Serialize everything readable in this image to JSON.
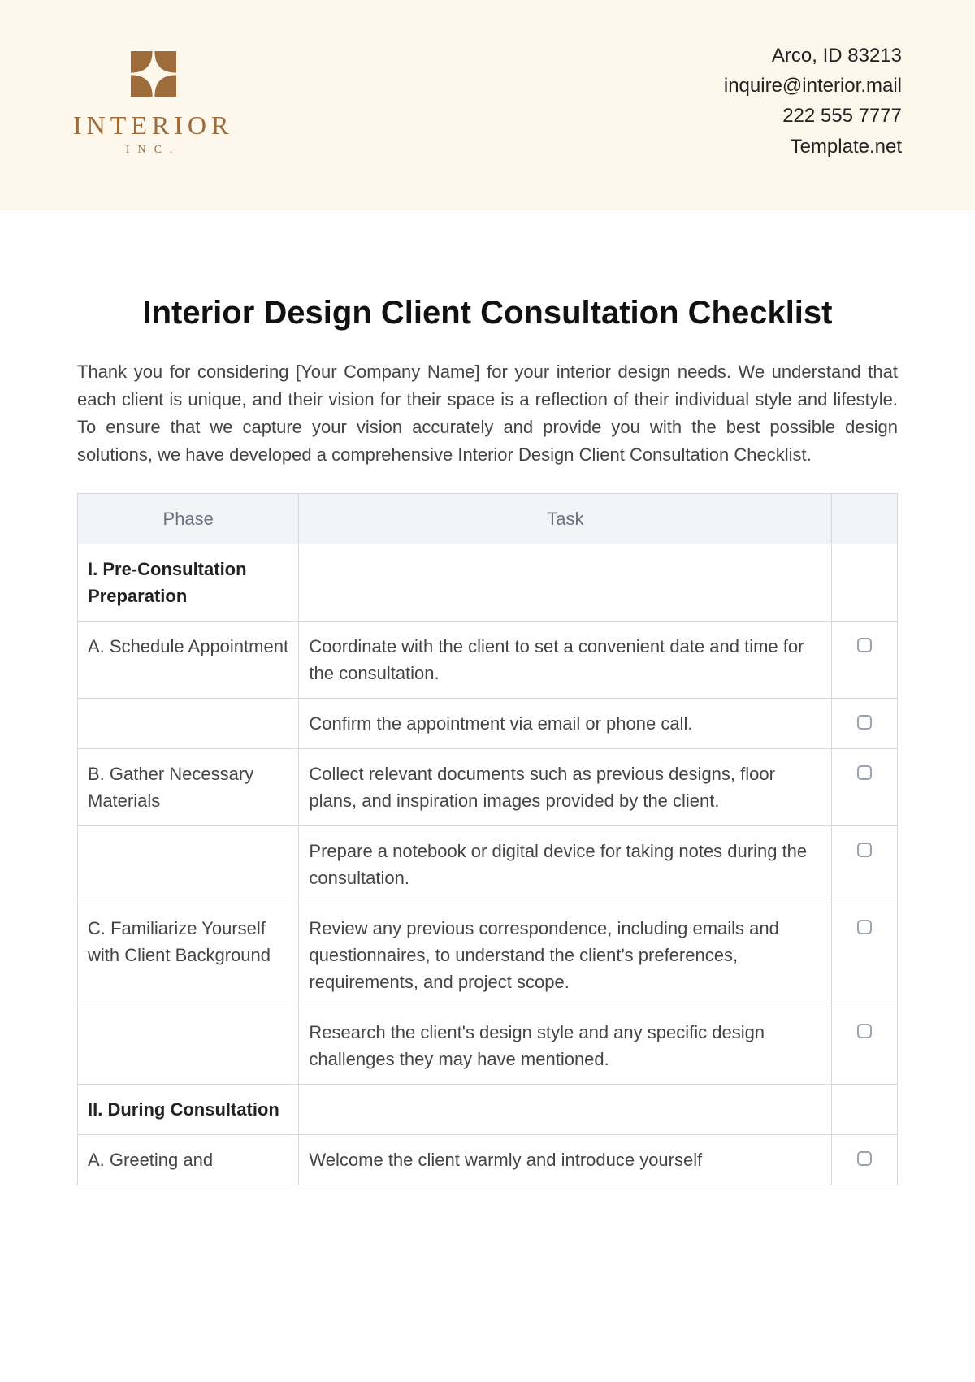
{
  "header": {
    "logo": {
      "name": "INTERIOR",
      "sub": "INC."
    },
    "contact": {
      "address": "Arco, ID 83213",
      "email": "inquire@interior.mail",
      "phone": "222 555 7777",
      "site": "Template.net"
    }
  },
  "title": "Interior Design Client Consultation Checklist",
  "intro": "Thank you for considering [Your Company Name] for your interior design needs. We understand that each client is unique, and their vision for their space is a reflection of their individual style and lifestyle. To ensure that we capture your vision accurately and provide you with the best possible design solutions, we have developed a comprehensive Interior Design Client Consultation Checklist.",
  "columns": {
    "phase": "Phase",
    "task": "Task"
  },
  "rows": [
    {
      "phase": "I. Pre-Consultation Preparation",
      "task": "",
      "isHead": true,
      "check": false
    },
    {
      "phase": "A. Schedule Appointment",
      "task": "Coordinate with the client to set a convenient date and time for the consultation.",
      "isHead": false,
      "check": true
    },
    {
      "phase": "",
      "task": "Confirm the appointment via email or phone call.",
      "isHead": false,
      "check": true
    },
    {
      "phase": "B. Gather Necessary Materials",
      "task": "Collect relevant documents such as previous designs, floor plans, and inspiration images provided by the client.",
      "isHead": false,
      "check": true
    },
    {
      "phase": "",
      "task": "Prepare a notebook or digital device for taking notes during the consultation.",
      "isHead": false,
      "check": true
    },
    {
      "phase": "C. Familiarize Yourself with Client Background",
      "task": "Review any previous correspondence, including emails and questionnaires, to understand the client's preferences, requirements, and project scope.",
      "isHead": false,
      "check": true
    },
    {
      "phase": "",
      "task": "Research the client's design style and any specific design challenges they may have mentioned.",
      "isHead": false,
      "check": true
    },
    {
      "phase": "II. During Consultation",
      "task": "",
      "isHead": true,
      "check": false
    },
    {
      "phase": "A. Greeting and",
      "task": "Welcome the client warmly and introduce yourself",
      "isHead": false,
      "check": true
    }
  ]
}
